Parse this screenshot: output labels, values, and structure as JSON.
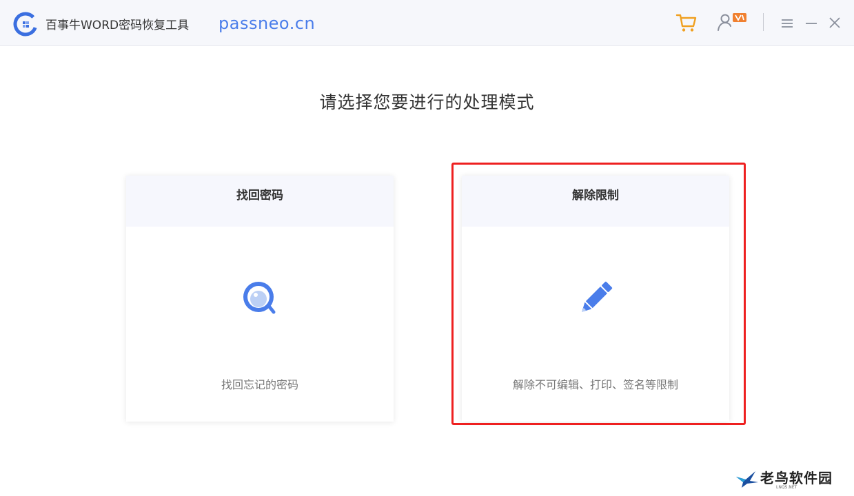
{
  "app": {
    "title": "百事牛WORD密码恢复工具",
    "url": "passneo.cn"
  },
  "toolbar": {
    "icons": [
      "cart-icon",
      "user-vip-icon",
      "menu-icon",
      "minimize-icon",
      "close-icon"
    ]
  },
  "main": {
    "heading": "请选择您要进行的处理模式",
    "modes": [
      {
        "title": "找回密码",
        "description": "找回忘记的密码",
        "icon": "search-icon"
      },
      {
        "title": "解除限制",
        "description": "解除不可编辑、打印、签名等限制",
        "icon": "pencil-icon"
      }
    ]
  },
  "watermark": {
    "text": "老鸟软件园",
    "sub": "LNQS.NET"
  },
  "colors": {
    "accent": "#4a7dea",
    "highlight": "#ee2020",
    "cart": "#f0a020",
    "badge": "#f08030",
    "titlebar_bg": "#f6f7fb",
    "card_head_bg": "#f6f7fd"
  }
}
